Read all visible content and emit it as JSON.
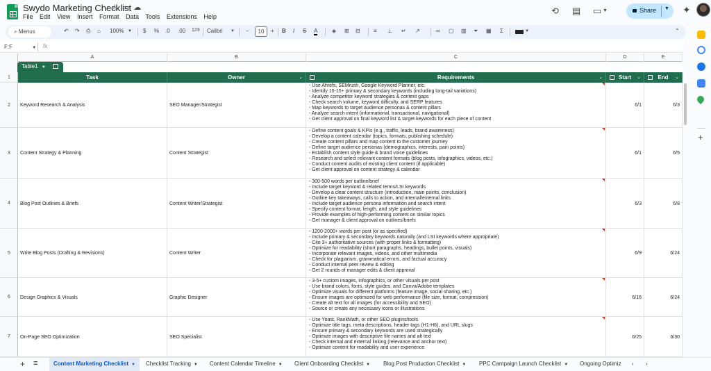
{
  "app": {
    "doc_title": "Swydo Marketing Checklist",
    "menu": [
      "File",
      "Edit",
      "View",
      "Insert",
      "Format",
      "Data",
      "Tools",
      "Extensions",
      "Help"
    ],
    "share_label": "Share"
  },
  "toolbar": {
    "menus_label": "Menus",
    "zoom": "100%",
    "currency": "$",
    "percent": "%",
    "decimal_dec": ".0",
    "decimal_inc": ".00",
    "number_format": "123",
    "font": "Calibri",
    "font_size": "10"
  },
  "formula_bar": {
    "name_box": "F:F",
    "fx": "fx"
  },
  "columns": [
    "A",
    "B",
    "C",
    "D",
    "E"
  ],
  "table": {
    "chip": "Table1",
    "headers": {
      "task": "Task",
      "owner": "Owner",
      "requirements": "Requirements",
      "start": "Start",
      "end": "End"
    },
    "rows": [
      {
        "num": "2",
        "task": "Keyword Research & Analysis",
        "owner": "SEO Manager/Strategist",
        "requirements": [
          "- Use Ahrefs, SEMrush, Google Keyword Planner, etc.",
          "- Identify 10-15+ primary & secondary keywords (including long-tail variations)",
          "- Analyze competitor keyword strategies & content gaps",
          "- Check search volume, keyword difficulty, and SERP features",
          "- Map keywords to target audience personas & content pillars",
          "- Analyze search intent (informational, transactional, navigational)",
          "- Get client approval on final keyword list & target keywords for each piece of content"
        ],
        "start": "6/1",
        "end": "6/3"
      },
      {
        "num": "3",
        "task": "Content Strategy & Planning",
        "owner": "Content Strategist",
        "requirements": [
          "- Define content goals & KPIs (e.g., traffic, leads, brand awareness)",
          "- Develop a content calendar (topics, formats, publishing schedule)",
          "- Create content pillars and map content to the customer journey",
          "- Define target audience personas (demographics, interests, pain points)",
          "- Establish content style guide & brand voice guidelines",
          "- Research and select relevant content formats (blog posts, infographics, videos, etc.)",
          "- Conduct content audits of existing client content (if applicable)",
          "- Get client approval on content strategy & calendar"
        ],
        "start": "6/1",
        "end": "6/5"
      },
      {
        "num": "4",
        "task": "Blog Post Outlines & Briefs",
        "owner": "Content Writer/Strategist",
        "requirements": [
          "- 300-500 words per outline/brief",
          "- Include target keyword & related terms/LSI keywords",
          "- Develop a clear content structure (introduction, main points, conclusion)",
          "- Outline key takeaways, calls to action, and internal/external links",
          "- Include target audience persona information and search intent",
          "- Specify content format, length, and style guidelines",
          "- Provide examples of high-performing content on similar topics",
          "- Get manager & client approval on outlines/briefs"
        ],
        "start": "6/3",
        "end": "6/8"
      },
      {
        "num": "5",
        "task": "Write Blog Posts (Drafting & Revisions)",
        "owner": "Content Writer",
        "requirements": [
          "- 1200-2000+ words per post (or as specified)",
          "- Include primary & secondary keywords naturally (and LSI keywords where appropriate)",
          "- Cite 3+ authoritative sources (with proper links & formatting)",
          "- Optimize for readability (short paragraphs, headings, bullet points, visuals)",
          "- Incorporate relevant images, videos, and other multimedia",
          "- Check for plagiarism, grammatical errors, and factual accuracy",
          "- Conduct internal peer review & editing",
          "- Get 2 rounds of manager edits & client approval"
        ],
        "start": "6/9",
        "end": "6/24"
      },
      {
        "num": "6",
        "task": "Design Graphics & Visuals",
        "owner": "Graphic Designer",
        "requirements": [
          "- 3-5+ custom images, infographics, or other visuals per post",
          "- Use brand colors, fonts, style guides, and Canva/Adobe templates",
          "- Optimize visuals for different platforms (feature image, social sharing, etc.)",
          "- Ensure images are optimized for web performance (file size, format, compression)",
          "- Create alt text for all images (for accessibility and SEO)",
          "- Source or create any necessary icons or illustrations"
        ],
        "start": "6/16",
        "end": "6/24"
      },
      {
        "num": "7",
        "task": "On-Page SEO Optimization",
        "owner": "SEO Specialist",
        "requirements": [
          "- Use Yoast, RankMath, or other SEO plugins/tools",
          "- Optimize title tags, meta descriptions, header tags (H1-H6), and URL slugs",
          "- Ensure primary & secondary keywords are used strategically",
          "- Optimize images with descriptive file names and alt text",
          "- Check internal and external linking (relevance and anchor text)",
          "- Optimize content for readability and user experience"
        ],
        "start": "6/25",
        "end": "6/30"
      }
    ]
  },
  "sheet_tabs": [
    "Content Marketing Checklist",
    "Checklist Tracking",
    "Content Calendar Timeline",
    "Client Onboarding Checklist",
    "Blog Post Production Checklist",
    "PPC Campaign Launch Checklist",
    "Ongoing Optimiz"
  ],
  "colors": {
    "table_header": "#216e4e",
    "active_tab": "#0b57d0",
    "share_bg": "#c2e7ff"
  }
}
